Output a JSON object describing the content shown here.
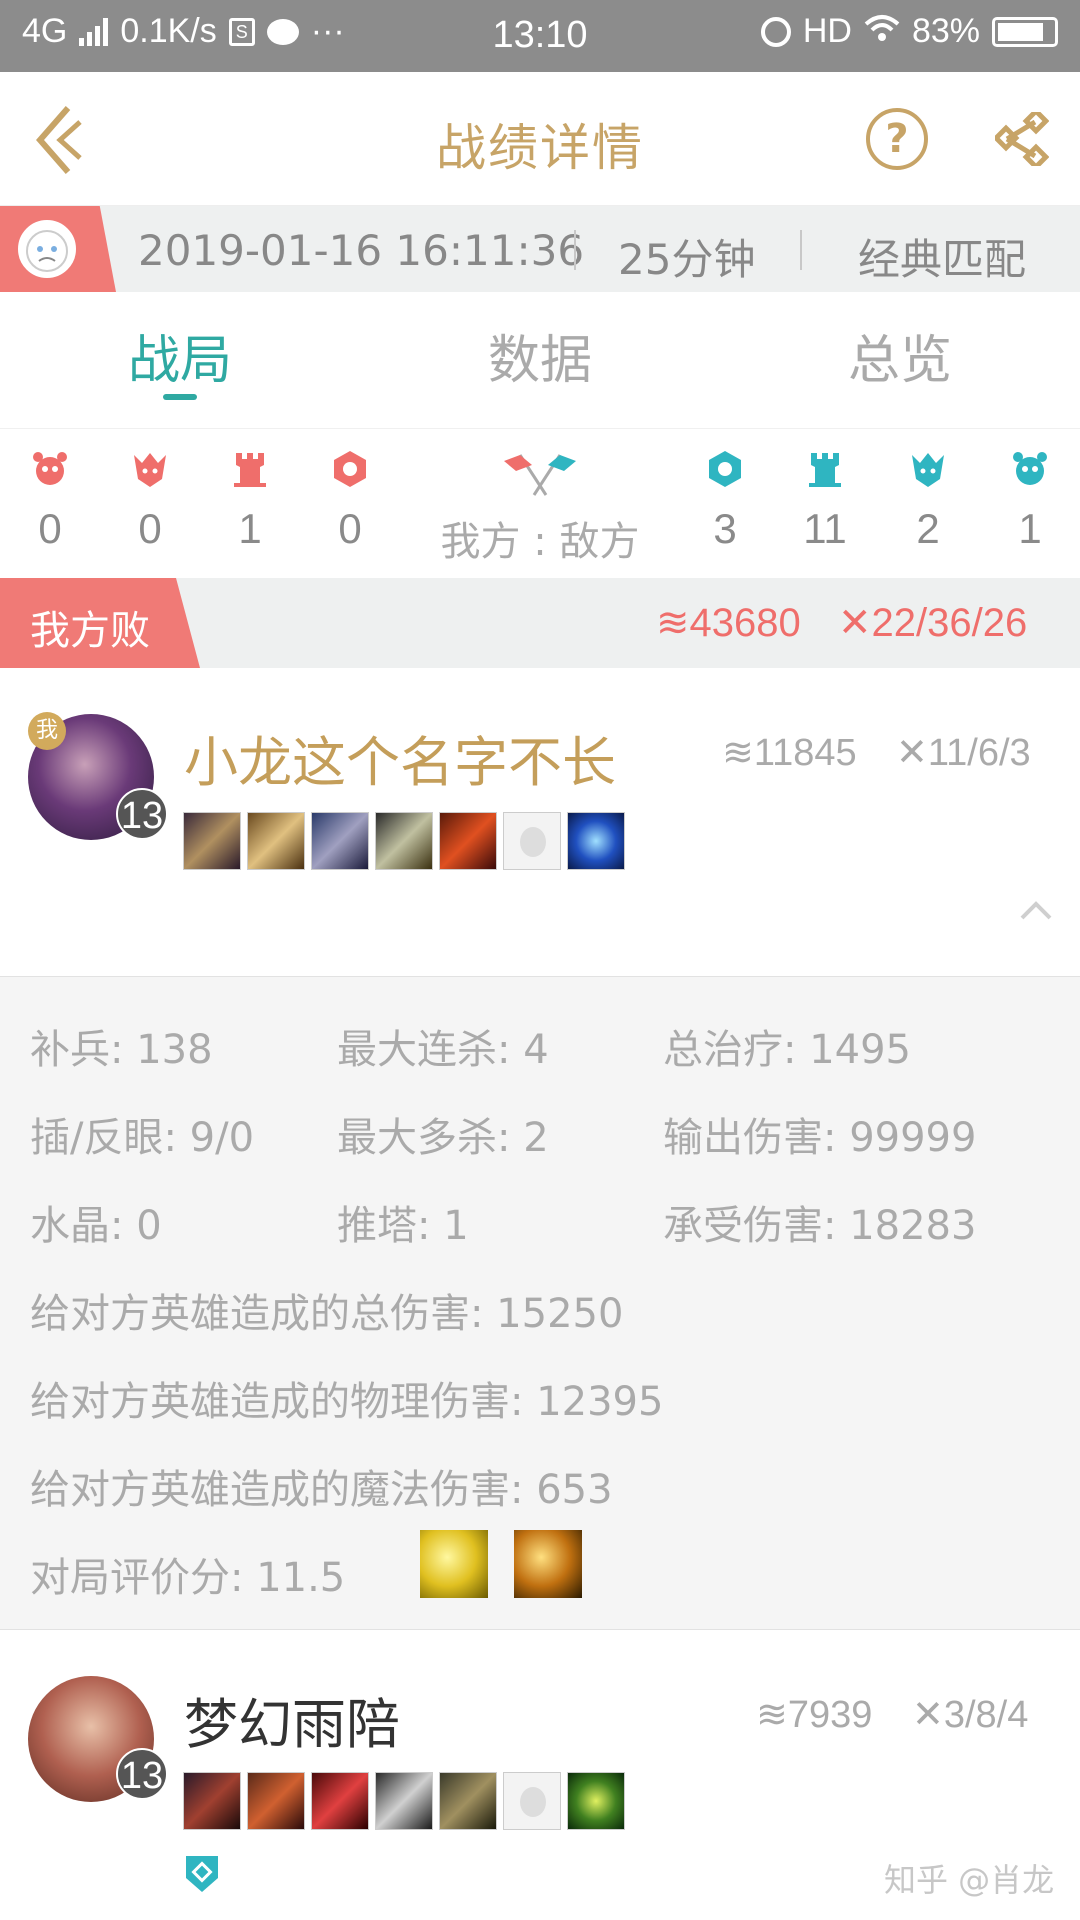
{
  "status_bar": {
    "network": "4G",
    "speed": "0.1K/s",
    "more": "···",
    "time": "13:10",
    "hd": "HD",
    "battery": "83%"
  },
  "header": {
    "title": "战绩详情",
    "help_label": "?"
  },
  "match": {
    "datetime": "2019-01-16 16:11:36",
    "duration": "25分钟",
    "mode": "经典匹配"
  },
  "tabs": [
    {
      "label": "战局",
      "active": true
    },
    {
      "label": "数据",
      "active": false
    },
    {
      "label": "总览",
      "active": false
    }
  ],
  "objectives": {
    "our": [
      {
        "icon": "baron-icon",
        "value": "0"
      },
      {
        "icon": "dragon-icon",
        "value": "0"
      },
      {
        "icon": "tower-icon",
        "value": "1"
      },
      {
        "icon": "inhibitor-icon",
        "value": "0"
      }
    ],
    "versus_label": "我方 : 敌方",
    "enemy": [
      {
        "icon": "inhibitor-icon",
        "value": "3"
      },
      {
        "icon": "tower-icon",
        "value": "11"
      },
      {
        "icon": "dragon-icon",
        "value": "2"
      },
      {
        "icon": "baron-icon",
        "value": "1"
      }
    ],
    "colors": {
      "our": "#ef6e6b",
      "enemy": "#2fb5c1"
    }
  },
  "result": {
    "label": "我方败",
    "gold": "43680",
    "kda": "22/36/26"
  },
  "players": [
    {
      "me_badge": "我",
      "name": "小龙这个名字不长",
      "level": "13",
      "gold": "11845",
      "kda": "11/6/3",
      "items": [
        "sword-item-icon",
        "armor-item-icon",
        "blade-item-icon",
        "axe-item-icon",
        "flame-blade-item-icon",
        "empty",
        "crystal-item-icon"
      ],
      "stats": {
        "cs": "补兵: 138",
        "max_kill_streak": "最大连杀: 4",
        "total_heal": "总治疗: 1495",
        "wards": "插/反眼: 9/0",
        "max_multikill": "最大多杀: 2",
        "damage_dealt": "输出伤害: 99999",
        "crystal": "水晶: 0",
        "towers": "推塔: 1",
        "damage_taken": "承受伤害: 18283",
        "total_champ_damage": "给对方英雄造成的总伤害: 15250",
        "physical_champ_damage": "给对方英雄造成的物理伤害: 12395",
        "magic_champ_damage": "给对方英雄造成的魔法伤害: 653",
        "score": "对局评价分: 11.5"
      },
      "spells": [
        "flash-spell-icon",
        "ignite-spell-icon"
      ]
    },
    {
      "name": "梦幻雨陪",
      "level": "13",
      "gold": "7939",
      "kda": "3/8/4",
      "items": [
        "gauntlet-item-icon",
        "claw-item-icon",
        "dagger-item-icon",
        "greatsword-item-icon",
        "boots-item-icon",
        "empty",
        "vine-item-icon"
      ]
    }
  ],
  "watermark": "知乎 @肖龙"
}
